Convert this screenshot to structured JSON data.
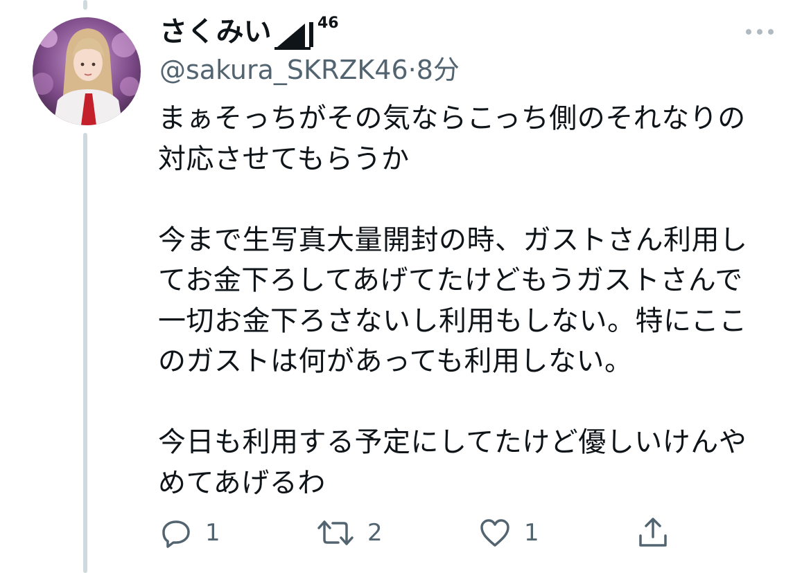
{
  "tweet": {
    "display_name": "さくみい",
    "name_suffix": "46",
    "handle": "@sakura_SKRZK46",
    "time": "·8分",
    "text": "まぁそっちがその気ならこっち側のそれなりの\n対応させてもらうか\n\n今まで生写真大量開封の時、ガストさん利用し\nてお金下ろしてあげてたけどもうガストさんで\n一切お金下ろさないし利用もしない。特にここ\nのガストは何があっても利用しない。\n\n今日も利用する予定にしてたけど優しいけんや\nめてあげるわ",
    "actions": {
      "reply_count": "1",
      "retweet_count": "2",
      "like_count": "1"
    }
  },
  "colors": {
    "text": "#0f1419",
    "secondary": "#536471",
    "thread_line": "#cfd9de"
  },
  "icons": [
    "more-icon",
    "reply-icon",
    "retweet-icon",
    "like-icon",
    "share-icon"
  ]
}
